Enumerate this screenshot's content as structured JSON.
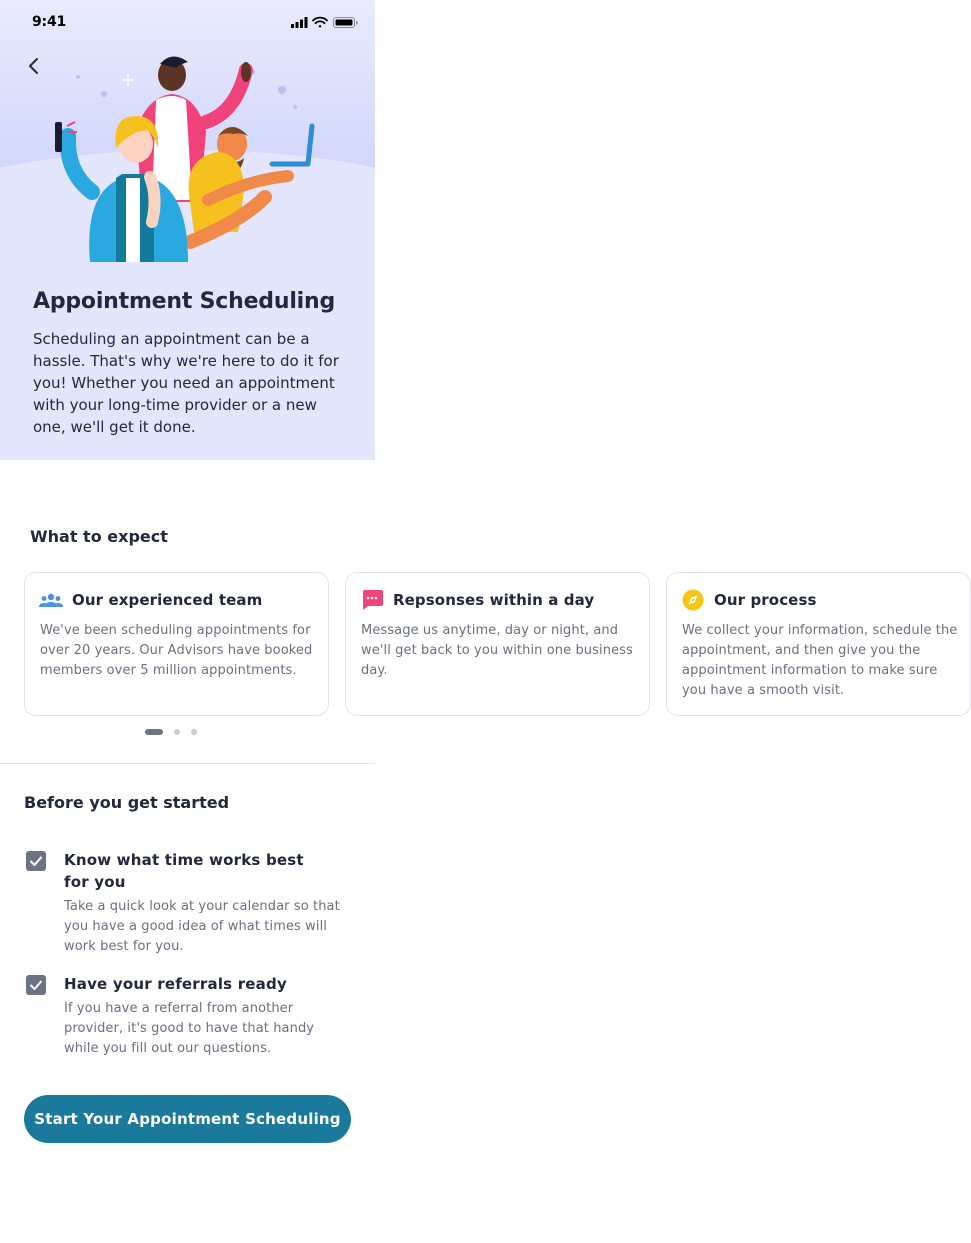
{
  "status_bar": {
    "time": "9:41"
  },
  "hero": {
    "title": "Appointment Scheduling",
    "description": "Scheduling an appointment can be a hassle. That's why we're here to do it for you! Whether you need an appointment with your long-time provider or a new one, we'll get it done."
  },
  "expect": {
    "heading": "What to expect",
    "cards": [
      {
        "icon": "people-icon",
        "icon_color": "#4a8ee6",
        "title": "Our experienced team",
        "text": "We've been scheduling appointments for over 20 years. Our Advisors have booked members over 5 million appointments."
      },
      {
        "icon": "chat-bubble-icon",
        "icon_color": "#f0447a",
        "title": "Repsonses within a day",
        "text": "Message us anytime, day or night, and we'll get back to you within one business day."
      },
      {
        "icon": "compass-icon",
        "icon_color": "#f5c518",
        "title": "Our process",
        "text": "We collect your information, schedule the appointment, and then give you the appointment information to make sure you have a smooth visit."
      }
    ],
    "pagination": {
      "current": 1,
      "total": 3
    }
  },
  "before": {
    "heading": "Before you get started",
    "items": [
      {
        "checked": true,
        "title": "Know what time works best for you",
        "text": "Take a quick look at your calendar so that you have a good idea of what times will work best for you."
      },
      {
        "checked": true,
        "title": "Have your referrals ready",
        "text": "If you have a referral from another provider, it's good to have that handy while you fill out our questions."
      }
    ]
  },
  "cta": {
    "label": "Start Your Appointment Scheduling"
  },
  "colors": {
    "accent": "#1b7a9c",
    "hero_bg": "#e3e6fc",
    "checkbox": "#6d7385"
  }
}
